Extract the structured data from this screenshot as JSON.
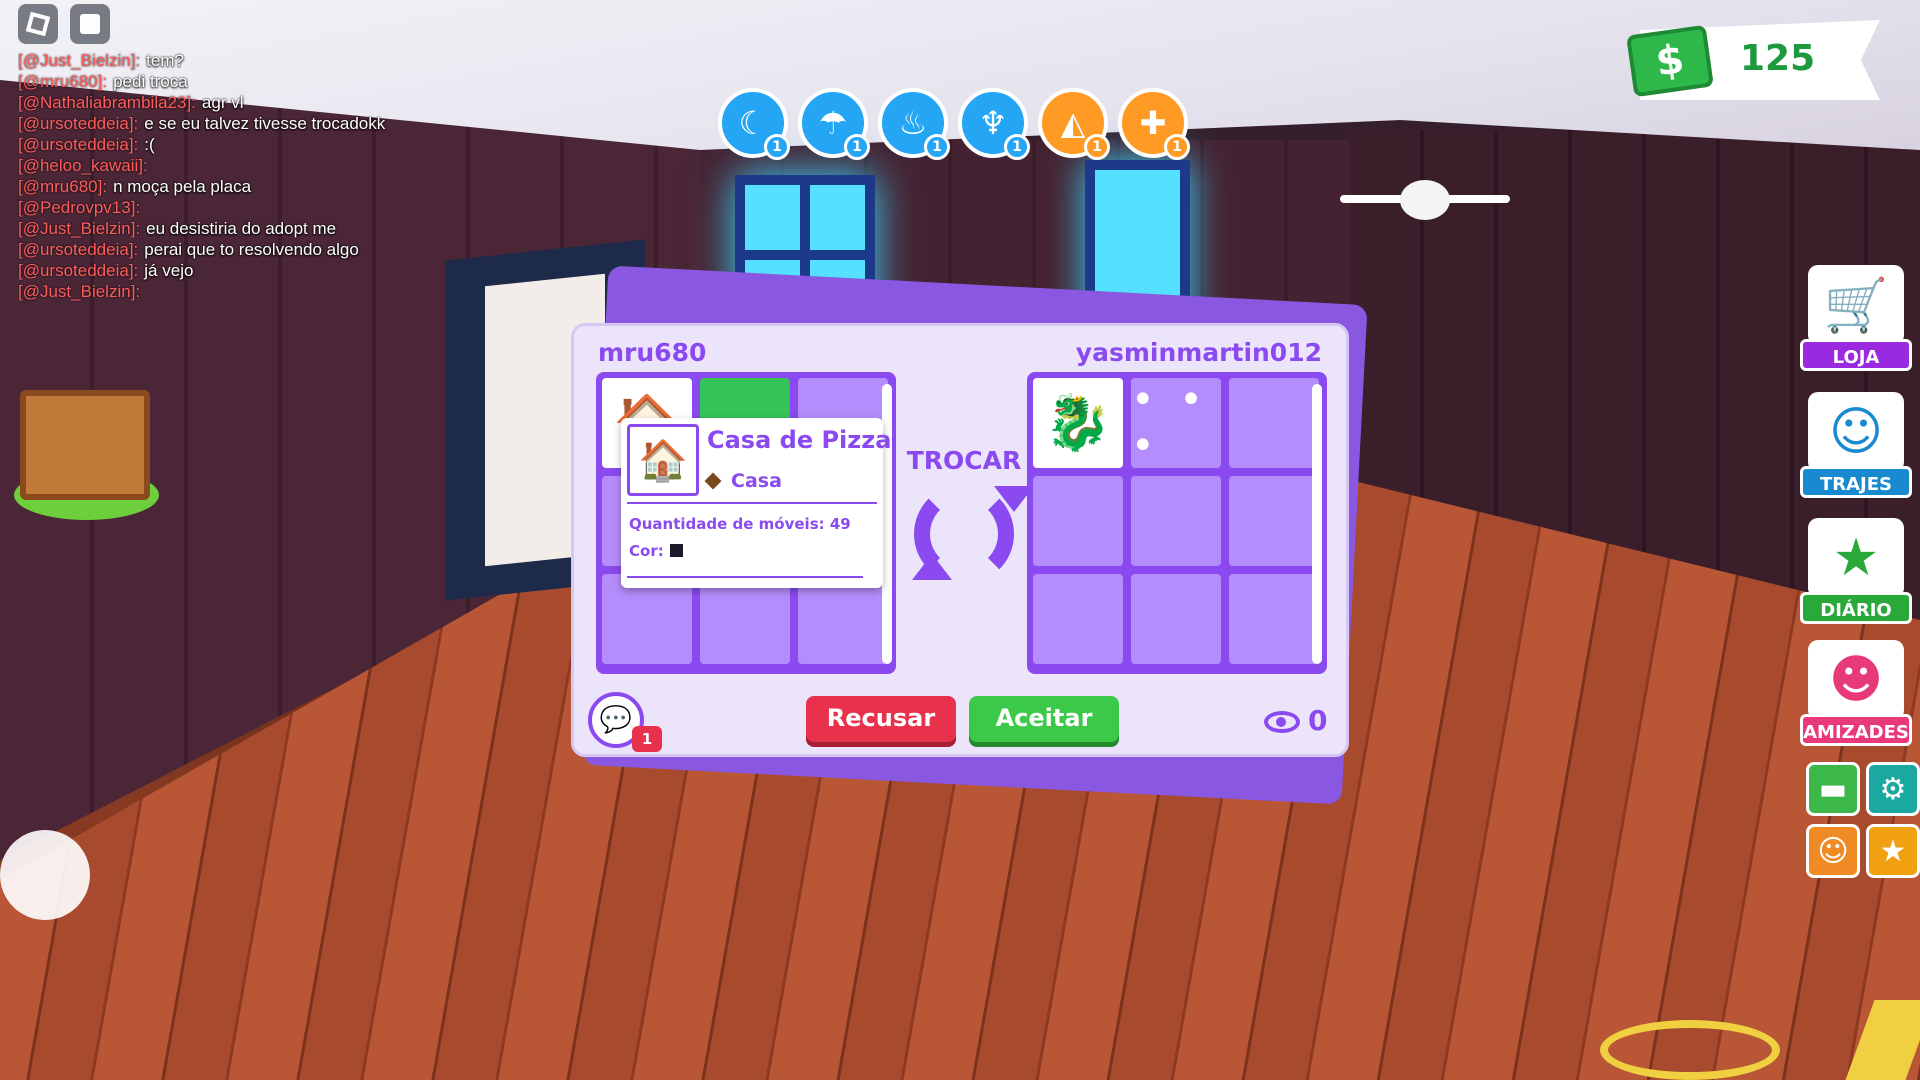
{
  "hud": {
    "money": "125",
    "needs": [
      {
        "icon": "sleep-icon",
        "glyph": "☾",
        "count": "1",
        "color": "#24a6f5"
      },
      {
        "icon": "shower-icon",
        "glyph": "☂",
        "count": "1",
        "color": "#24a6f5"
      },
      {
        "icon": "drink-icon",
        "glyph": "♨",
        "count": "1",
        "color": "#24a6f5"
      },
      {
        "icon": "food-icon",
        "glyph": "♆",
        "count": "1",
        "color": "#24a6f5"
      },
      {
        "icon": "pizza-icon",
        "glyph": "◭",
        "count": "1",
        "color": "#ff9a24"
      },
      {
        "icon": "health-icon",
        "glyph": "✚",
        "count": "1",
        "color": "#ff9a24"
      }
    ]
  },
  "chat": [
    {
      "user": "[@Just_Bielzin]:",
      "msg": "tem?"
    },
    {
      "user": "[@mru680]:",
      "msg": "pedi troca"
    },
    {
      "user": "[@Nathaliabrambila23]:",
      "msg": "agr vl"
    },
    {
      "user": "[@ursoteddeia]:",
      "msg": "e se eu talvez tivesse trocadokk"
    },
    {
      "user": "[@ursoteddeia]:",
      "msg": ":("
    },
    {
      "user": "[@heloo_kawaii]:",
      "msg": ""
    },
    {
      "user": "[@mru680]:",
      "msg": "n moça pela placa"
    },
    {
      "user": "[@Pedrovpv13]:",
      "msg": ""
    },
    {
      "user": "[@Just_Bielzin]:",
      "msg": "eu desistiria do adopt me"
    },
    {
      "user": "[@ursoteddeia]:",
      "msg": "perai que to resolvendo algo"
    },
    {
      "user": "[@ursoteddeia]:",
      "msg": "já vejo"
    },
    {
      "user": "[@Just_Bielzin]:",
      "msg": ""
    }
  ],
  "menu": {
    "loja": "LOJA",
    "trajes": "TRAJES",
    "diario": "DIÁRIO",
    "amizades": "AMIZADES"
  },
  "trade": {
    "left_player": "mru680",
    "right_player": "yasminmartin012",
    "trocar": "TROCAR",
    "decline": "Recusar",
    "accept": "Aceitar",
    "viewers": "0",
    "chat_badge": "1",
    "more": "• • •",
    "add": "+"
  },
  "tooltip": {
    "title": "Casa de Pizza",
    "category": "Casa",
    "quantity": "Quantidade de móveis: 49",
    "color_label": "Cor:"
  }
}
